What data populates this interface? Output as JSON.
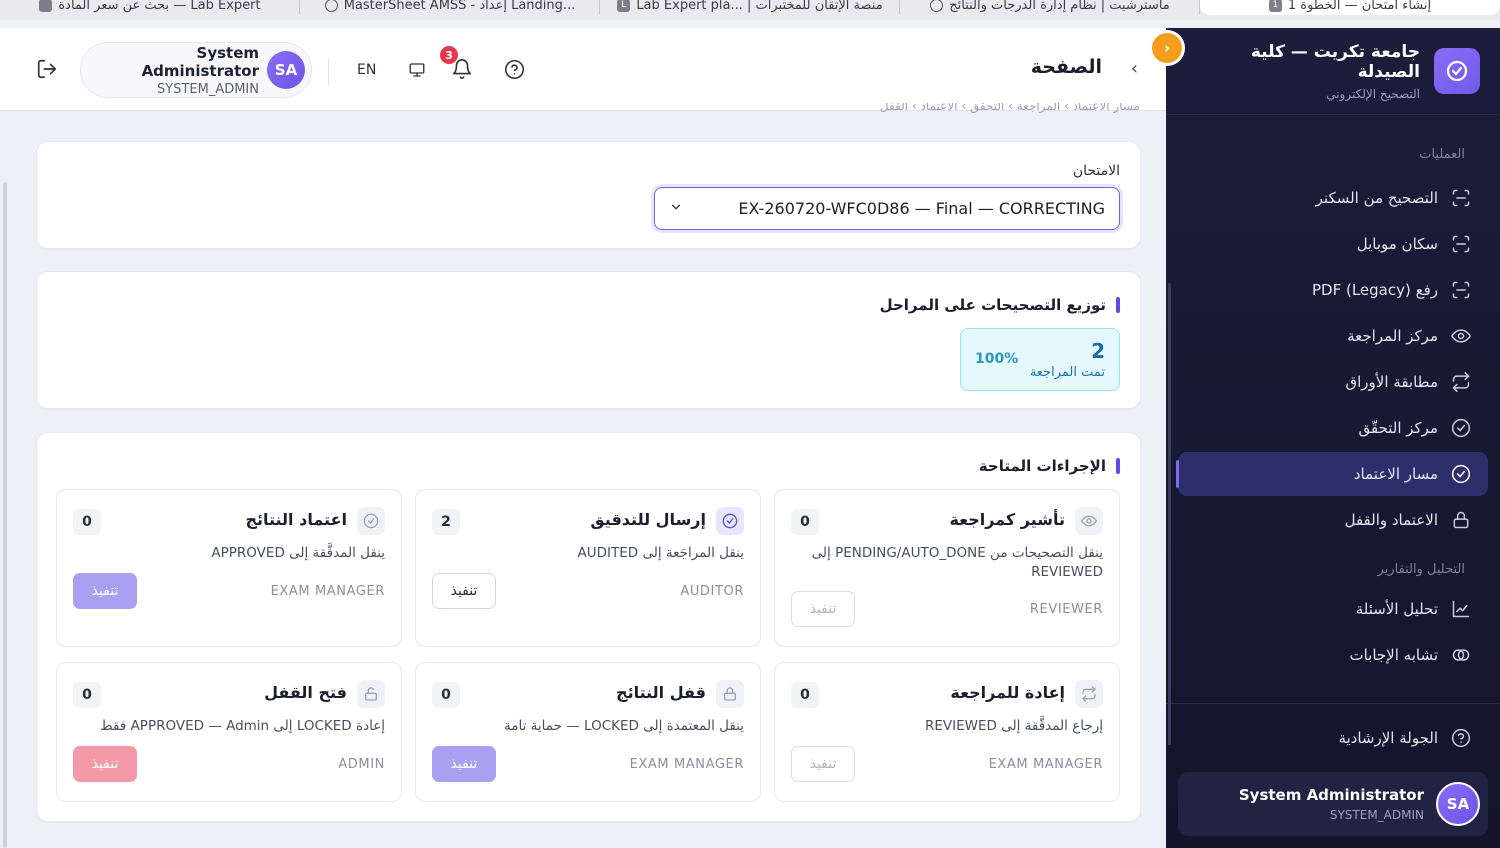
{
  "browser_tabs": [
    {
      "label": "بحث عن سعر المادة — Lab Expert"
    },
    {
      "label": "MasterSheet AMSS - إعداد Landing..."
    },
    {
      "label": "Lab Expert pla... | منصة الإتقان للمختبرات"
    },
    {
      "label": "ماسترشيت | نظام إدارة الدرجات والنتائج"
    },
    {
      "label": "إنشاء امتحان — الخطوة 1",
      "badge": "1"
    }
  ],
  "sidebar": {
    "brand_title": "جامعة تكريت — كلية الصيدلة",
    "brand_sub": "التصحيح الإلكتروني",
    "section_ops": "العمليات",
    "ops_items": [
      {
        "label": "التصحيح من السكنر",
        "icon": "scan-icon"
      },
      {
        "label": "سكان موبايل",
        "icon": "scan-icon"
      },
      {
        "label": "رفع PDF (Legacy)",
        "icon": "scan-icon"
      },
      {
        "label": "مركز المراجعة",
        "icon": "eye-icon"
      },
      {
        "label": "مطابقة الأوراق",
        "icon": "swap-icon"
      },
      {
        "label": "مركز التحقّق",
        "icon": "check-circle-icon"
      },
      {
        "label": "مسار الاعتماد",
        "icon": "check-circle-icon",
        "active": true
      },
      {
        "label": "الاعتماد والقفل",
        "icon": "lock-icon"
      }
    ],
    "section_reports": "التحليل والتقارير",
    "report_items": [
      {
        "label": "تحليل الأسئلة",
        "icon": "chart-icon"
      },
      {
        "label": "تشابه الإجابات",
        "icon": "overlap-icon"
      }
    ],
    "tour_label": "الجولة الإرشادية",
    "user_name": "System Administrator",
    "user_role": "SYSTEM_ADMIN",
    "user_initials": "SA"
  },
  "header": {
    "page_title": "الصفحة",
    "lang": "EN",
    "notif_count": "3",
    "user_name": "System Administrator",
    "user_role": "SYSTEM_ADMIN",
    "user_initials": "SA"
  },
  "breadcrumb": "مسار الاعتماد › المراجعة › التحقق › الاعتماد › القفل",
  "exam": {
    "label": "الامتحان",
    "value": "EX-260720-WFC0D86 — Final — CORRECTING"
  },
  "stages": {
    "title": "توزيع التصحيحات على المراحل",
    "count": "2",
    "label": "تمت المراجعة",
    "percent": "100%"
  },
  "actions": {
    "title": "الإجراءات المتاحة",
    "exec_label": "تنفيذ",
    "items": [
      {
        "title": "تأشير كمراجعة",
        "count": "0",
        "desc": "ينقل التصحيحات من PENDING/AUTO_DONE إلى REVIEWED",
        "role": "REVIEWER",
        "icon": "eye-icon"
      },
      {
        "title": "إرسال للتدقيق",
        "count": "2",
        "desc": "ينقل المراجَعة إلى AUDITED",
        "role": "AUDITOR",
        "icon": "check-circle-icon"
      },
      {
        "title": "اعتماد النتائج",
        "count": "0",
        "desc": "ينقل المدقَّقة إلى APPROVED",
        "role": "EXAM MANAGER",
        "icon": "check-circle-icon"
      },
      {
        "title": "إعادة للمراجعة",
        "count": "0",
        "desc": "إرجاع المدقَّقة إلى REVIEWED",
        "role": "EXAM MANAGER",
        "icon": "swap-icon"
      },
      {
        "title": "قفل النتائج",
        "count": "0",
        "desc": "ينقل المعتمدة إلى LOCKED — حماية تامة",
        "role": "EXAM MANAGER",
        "icon": "lock-icon"
      },
      {
        "title": "فتح القفل",
        "count": "0",
        "desc": "إعادة LOCKED إلى APPROVED — Admin فقط",
        "role": "ADMIN",
        "icon": "unlock-icon"
      }
    ]
  },
  "colors": {
    "accent": "#5a4fe2",
    "sidebar_bg": "#1b1d3a",
    "warning": "#f59e1b",
    "danger_button": "#f29aa8",
    "primary_button": "#a9a0f2",
    "stage_bg": "#e5f8fd"
  }
}
